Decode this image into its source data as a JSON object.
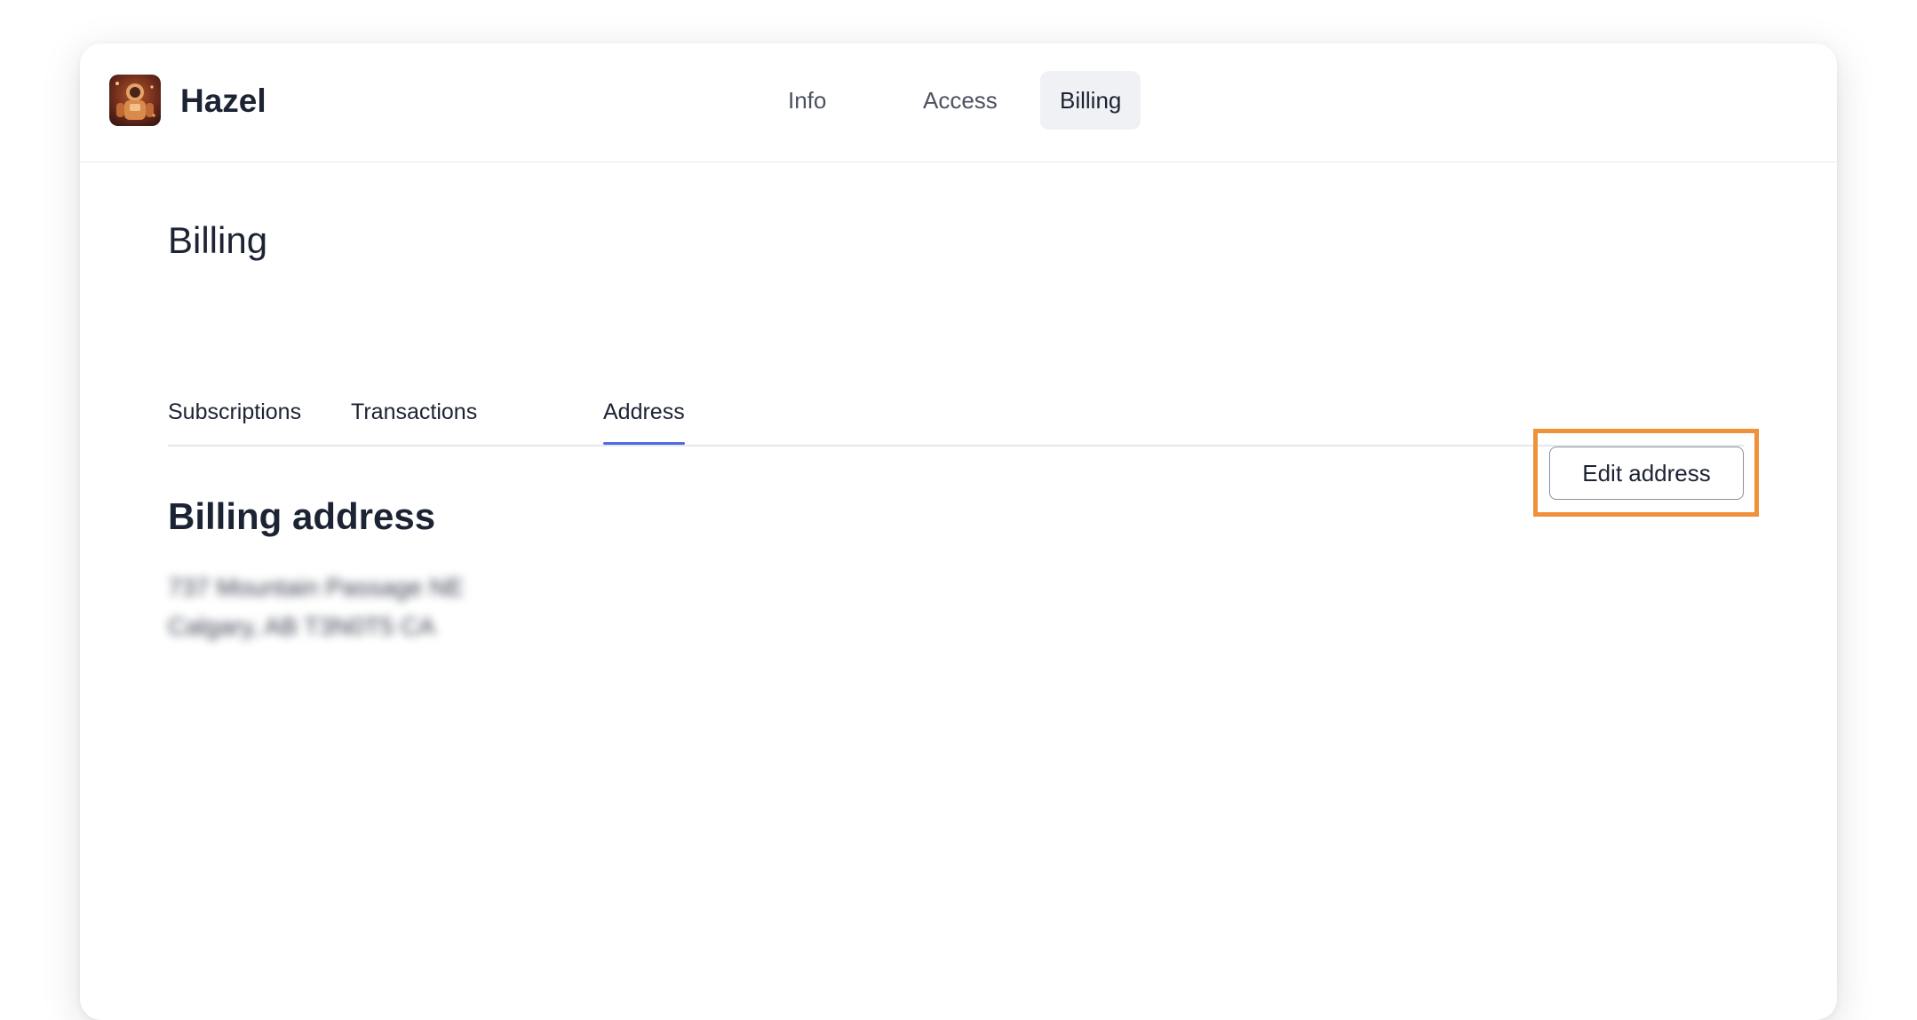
{
  "header": {
    "app_name": "Hazel",
    "avatar_icon": "astronaut-avatar-icon",
    "nav": [
      {
        "label": "Info",
        "active": false
      },
      {
        "label": "Access",
        "active": false
      },
      {
        "label": "Billing",
        "active": true
      }
    ]
  },
  "page": {
    "title": "Billing",
    "tabs": [
      {
        "label": "Subscriptions",
        "active": false
      },
      {
        "label": "Transactions",
        "active": false
      },
      {
        "label": "Address",
        "active": true
      }
    ]
  },
  "address_section": {
    "title": "Billing address",
    "edit_label": "Edit address",
    "lines": [
      "737 Mountain Passage NE",
      "Calgary, AB T3N0T5 CA"
    ]
  },
  "colors": {
    "accent": "#4f6ae6",
    "highlight": "#f0913a",
    "text": "#1c2333"
  }
}
